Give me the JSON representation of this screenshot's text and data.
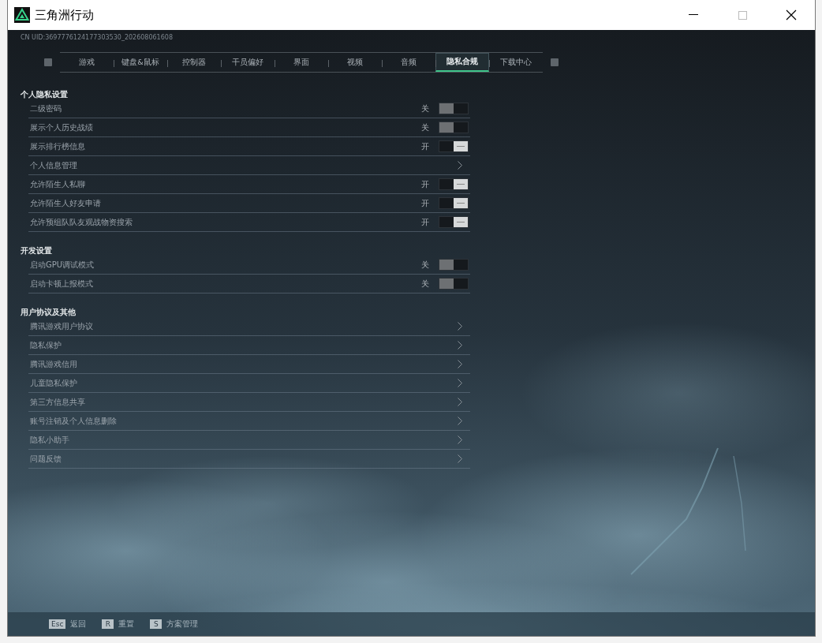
{
  "window": {
    "title": "三角洲行动"
  },
  "uid": "CN UID:3697776124177303530_202608061608",
  "tabs": [
    {
      "label": "游戏",
      "selected": false
    },
    {
      "label": "键盘&鼠标",
      "selected": false
    },
    {
      "label": "控制器",
      "selected": false
    },
    {
      "label": "干员偏好",
      "selected": false
    },
    {
      "label": "界面",
      "selected": false
    },
    {
      "label": "视频",
      "selected": false
    },
    {
      "label": "音频",
      "selected": false
    },
    {
      "label": "隐私合规",
      "selected": true
    },
    {
      "label": "下载中心",
      "selected": false
    }
  ],
  "sections": [
    {
      "title": "个人隐私设置",
      "rows": [
        {
          "kind": "toggle",
          "label": "二级密码",
          "on": false,
          "state_text": "关"
        },
        {
          "kind": "toggle",
          "label": "展示个人历史战绩",
          "on": false,
          "state_text": "关"
        },
        {
          "kind": "toggle",
          "label": "展示排行榜信息",
          "on": true,
          "state_text": "开"
        },
        {
          "kind": "link",
          "label": "个人信息管理"
        },
        {
          "kind": "toggle",
          "label": "允许陌生人私聊",
          "on": true,
          "state_text": "开"
        },
        {
          "kind": "toggle",
          "label": "允许陌生人好友申请",
          "on": true,
          "state_text": "开"
        },
        {
          "kind": "toggle",
          "label": "允许预组队队友观战物资搜索",
          "on": true,
          "state_text": "开"
        }
      ]
    },
    {
      "title": "开发设置",
      "rows": [
        {
          "kind": "toggle",
          "label": "启动GPU调试模式",
          "on": false,
          "state_text": "关"
        },
        {
          "kind": "toggle",
          "label": "启动卡顿上报模式",
          "on": false,
          "state_text": "关"
        }
      ]
    },
    {
      "title": "用户协议及其他",
      "rows": [
        {
          "kind": "link",
          "label": "腾讯游戏用户协议"
        },
        {
          "kind": "link",
          "label": "隐私保护"
        },
        {
          "kind": "link",
          "label": "腾讯游戏信用"
        },
        {
          "kind": "link",
          "label": "儿童隐私保护"
        },
        {
          "kind": "link",
          "label": "第三方信息共享"
        },
        {
          "kind": "link",
          "label": "账号注销及个人信息删除"
        },
        {
          "kind": "link",
          "label": "隐私小助手"
        },
        {
          "kind": "link",
          "label": "问题反馈"
        }
      ]
    }
  ],
  "footer": [
    {
      "key": "Esc",
      "label": "返回"
    },
    {
      "key": "R",
      "label": "重置"
    },
    {
      "key": "S",
      "label": "方案管理"
    }
  ]
}
